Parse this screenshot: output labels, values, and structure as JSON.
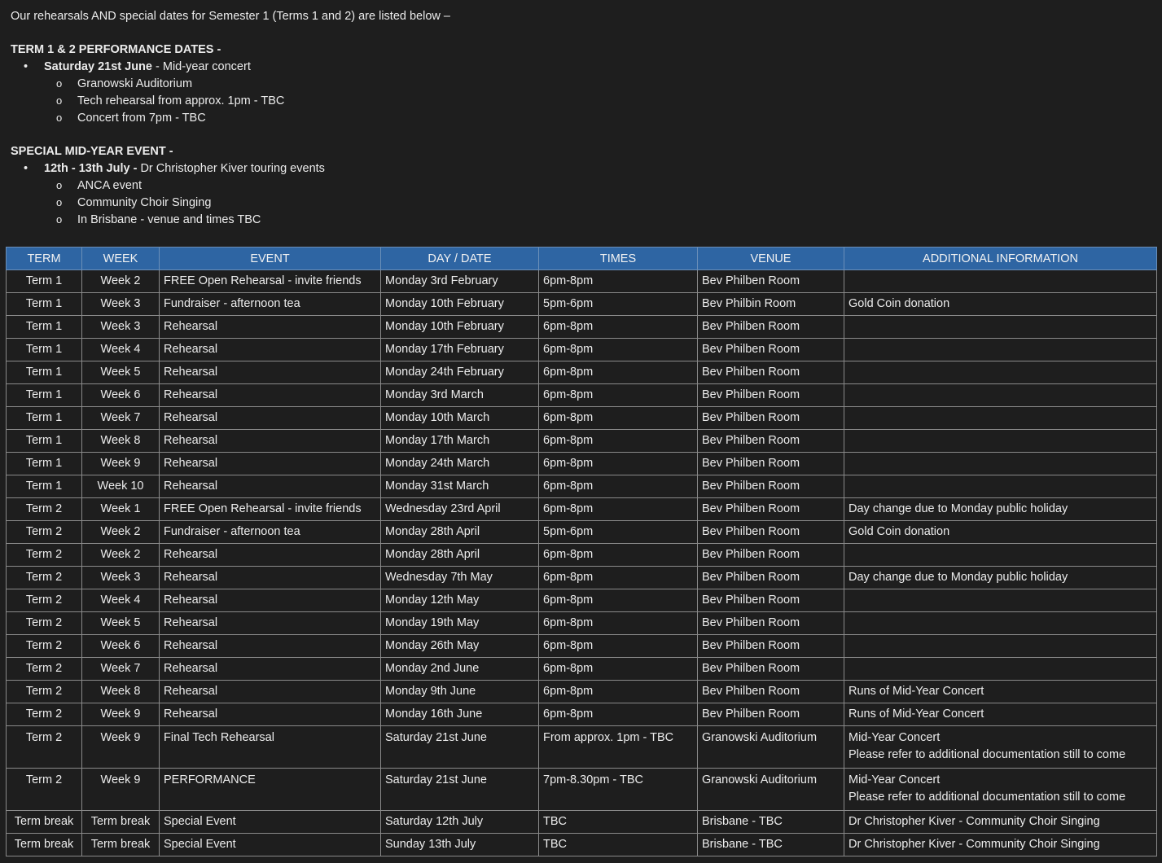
{
  "intro": {
    "line1": "Our rehearsals AND special dates for Semester 1 (Terms 1 and 2) are listed below –",
    "perf_heading": "TERM 1 & 2 PERFORMANCE DATES -",
    "perf_item_bold": "Saturday 21st June",
    "perf_item_rest": " - Mid-year concert",
    "perf_sub": [
      "Granowski Auditorium",
      "Tech rehearsal from approx. 1pm - TBC",
      "Concert from 7pm - TBC"
    ],
    "special_heading": "SPECIAL MID-YEAR EVENT -",
    "special_item_bold": "12th - 13th July -",
    "special_item_rest": " Dr Christopher Kiver touring events",
    "special_sub": [
      "ANCA event",
      "Community Choir Singing",
      "In Brisbane - venue and times TBC"
    ]
  },
  "table": {
    "headers": [
      "TERM",
      "WEEK",
      "EVENT",
      "DAY / DATE",
      "TIMES",
      "VENUE",
      "ADDITIONAL INFORMATION"
    ],
    "rows": [
      [
        "Term 1",
        "Week 2",
        "FREE Open Rehearsal - invite friends",
        "Monday 3rd February",
        "6pm-8pm",
        "Bev Philben Room",
        ""
      ],
      [
        "Term 1",
        "Week 3",
        "Fundraiser - afternoon tea",
        "Monday 10th February",
        "5pm-6pm",
        "Bev Philbin Room",
        "Gold Coin donation"
      ],
      [
        "Term 1",
        "Week 3",
        "Rehearsal",
        "Monday 10th February",
        "6pm-8pm",
        "Bev Philben Room",
        ""
      ],
      [
        "Term 1",
        "Week 4",
        "Rehearsal",
        "Monday 17th February",
        "6pm-8pm",
        "Bev Philben Room",
        ""
      ],
      [
        "Term 1",
        "Week 5",
        "Rehearsal",
        "Monday 24th February",
        "6pm-8pm",
        "Bev Philben Room",
        ""
      ],
      [
        "Term 1",
        "Week 6",
        "Rehearsal",
        "Monday 3rd March",
        "6pm-8pm",
        "Bev Philben Room",
        ""
      ],
      [
        "Term 1",
        "Week 7",
        "Rehearsal",
        "Monday 10th March",
        "6pm-8pm",
        "Bev Philben Room",
        ""
      ],
      [
        "Term 1",
        "Week 8",
        "Rehearsal",
        "Monday 17th March",
        "6pm-8pm",
        "Bev Philben Room",
        ""
      ],
      [
        "Term 1",
        "Week 9",
        "Rehearsal",
        "Monday 24th March",
        "6pm-8pm",
        "Bev Philben Room",
        ""
      ],
      [
        "Term 1",
        "Week 10",
        "Rehearsal",
        "Monday 31st March",
        "6pm-8pm",
        "Bev Philben Room",
        ""
      ],
      [
        "Term 2",
        "Week 1",
        "FREE Open Rehearsal - invite friends",
        "Wednesday 23rd April",
        "6pm-8pm",
        "Bev Philben Room",
        "Day change due to Monday public holiday"
      ],
      [
        "Term 2",
        "Week 2",
        "Fundraiser - afternoon tea",
        "Monday 28th April",
        "5pm-6pm",
        "Bev Philben Room",
        "Gold Coin donation"
      ],
      [
        "Term 2",
        "Week 2",
        "Rehearsal",
        "Monday 28th April",
        "6pm-8pm",
        "Bev Philben Room",
        ""
      ],
      [
        "Term 2",
        "Week 3",
        "Rehearsal",
        "Wednesday 7th May",
        "6pm-8pm",
        "Bev Philben Room",
        "Day change due to Monday public holiday"
      ],
      [
        "Term 2",
        "Week 4",
        "Rehearsal",
        "Monday 12th May",
        "6pm-8pm",
        "Bev Philben Room",
        ""
      ],
      [
        "Term 2",
        "Week 5",
        "Rehearsal",
        "Monday 19th May",
        "6pm-8pm",
        "Bev Philben Room",
        ""
      ],
      [
        "Term 2",
        "Week 6",
        "Rehearsal",
        "Monday 26th May",
        "6pm-8pm",
        "Bev Philben Room",
        ""
      ],
      [
        "Term 2",
        "Week 7",
        "Rehearsal",
        "Monday 2nd June",
        "6pm-8pm",
        "Bev Philben Room",
        ""
      ],
      [
        "Term 2",
        "Week 8",
        "Rehearsal",
        "Monday 9th June",
        "6pm-8pm",
        "Bev Philben Room",
        "Runs of Mid-Year Concert"
      ],
      [
        "Term 2",
        "Week 9",
        "Rehearsal",
        "Monday 16th June",
        "6pm-8pm",
        "Bev Philben Room",
        "Runs of Mid-Year Concert"
      ],
      [
        "Term 2",
        "Week 9",
        "Final Tech Rehearsal",
        "Saturday 21st June",
        "From approx. 1pm - TBC",
        "Granowski Auditorium",
        "Mid-Year Concert",
        "Please refer to additional documentation still to come"
      ],
      [
        "Term 2",
        "Week 9",
        "PERFORMANCE",
        "Saturday 21st June",
        "7pm-8.30pm - TBC",
        "Granowski Auditorium",
        "Mid-Year Concert",
        "Please refer to additional documentation still to come"
      ],
      [
        "Term break",
        "Term break",
        "Special Event",
        "Saturday 12th July",
        "TBC",
        "Brisbane - TBC",
        "Dr Christopher Kiver - Community Choir Singing"
      ],
      [
        "Term break",
        "Term break",
        "Special Event",
        "Sunday 13th July",
        "TBC",
        "Brisbane - TBC",
        "Dr Christopher Kiver - Community Choir Singing"
      ]
    ]
  }
}
